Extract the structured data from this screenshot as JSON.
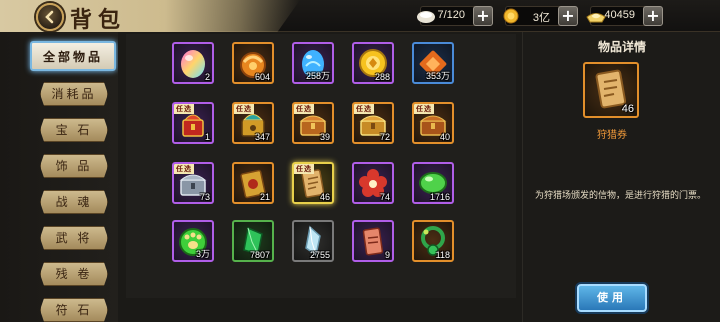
{
  "header": {
    "title": "背包",
    "resources": [
      {
        "icon": "capacity-icon",
        "value": "7/120"
      },
      {
        "icon": "gold-coin-icon",
        "value": "3亿"
      },
      {
        "icon": "silver-ingot-icon",
        "value": "40459"
      }
    ]
  },
  "nav": {
    "tabs": [
      {
        "label": "全部物品",
        "active": true
      },
      {
        "label": "消耗品"
      },
      {
        "label": "宝 石"
      },
      {
        "label": "饰 品"
      },
      {
        "label": "战 魂"
      },
      {
        "label": "武 将"
      },
      {
        "label": "残 卷"
      },
      {
        "label": "符 石"
      }
    ]
  },
  "grid": {
    "badge_label": "任选",
    "items": [
      {
        "icon": "rainbow-gem-icon",
        "qty": "2",
        "rarity": "purple"
      },
      {
        "icon": "orange-orb-icon",
        "qty": "604",
        "rarity": "orange"
      },
      {
        "icon": "blue-egg-icon",
        "qty": "258万",
        "rarity": "purple"
      },
      {
        "icon": "gold-medal-icon",
        "qty": "288",
        "rarity": "purple"
      },
      {
        "icon": "red-box-icon",
        "qty": "353万",
        "rarity": "blue"
      },
      {
        "icon": "red-helmet-chest-icon",
        "qty": "1",
        "rarity": "purple",
        "optional": true
      },
      {
        "icon": "gold-helmet-chest-icon",
        "qty": "347",
        "rarity": "orange",
        "optional": true
      },
      {
        "icon": "treasure-chest-icon",
        "qty": "39",
        "rarity": "orange",
        "optional": true
      },
      {
        "icon": "treasure-chest-icon",
        "qty": "72",
        "rarity": "orange",
        "optional": true
      },
      {
        "icon": "treasure-chest-icon",
        "qty": "40",
        "rarity": "orange",
        "optional": true
      },
      {
        "icon": "silver-chest-icon",
        "qty": "73",
        "rarity": "purple",
        "optional": true
      },
      {
        "icon": "gold-scroll-box-icon",
        "qty": "21",
        "rarity": "orange"
      },
      {
        "icon": "scroll-ticket-icon",
        "qty": "46",
        "rarity": "yellow",
        "optional": true
      },
      {
        "icon": "red-flower-icon",
        "qty": "74",
        "rarity": "purple"
      },
      {
        "icon": "green-orb-icon",
        "qty": "1716",
        "rarity": "purple"
      },
      {
        "icon": "green-paw-icon",
        "qty": "3万",
        "rarity": "purple"
      },
      {
        "icon": "green-crystal-icon",
        "qty": "7807",
        "rarity": "green"
      },
      {
        "icon": "white-crystal-icon",
        "qty": "2755",
        "rarity": "grey"
      },
      {
        "icon": "red-scroll-icon",
        "qty": "9",
        "rarity": "purple"
      },
      {
        "icon": "green-necklace-icon",
        "qty": "118",
        "rarity": "orange"
      }
    ]
  },
  "detail": {
    "title": "物品详情",
    "qty": "46",
    "name": "狩猎券",
    "description": "为狩猎场颁发的信物，是进行狩猎的门票。",
    "use_label": "使用"
  },
  "colors": {
    "purple": "#b05ee8",
    "orange": "#e28f2b",
    "yellow": "#e9d14b",
    "green": "#56b24c",
    "blue": "#4a8bd8",
    "grey": "#7a7a7a",
    "accent_button": "#2a78b8"
  }
}
